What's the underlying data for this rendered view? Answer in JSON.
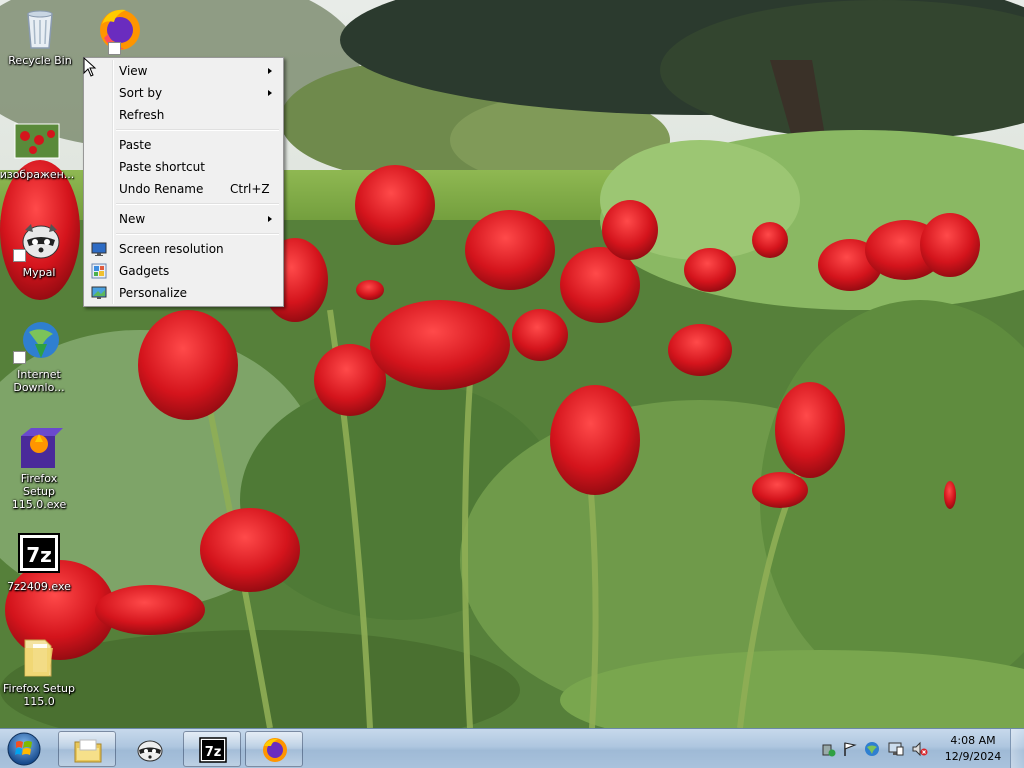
{
  "desktop": {
    "icons": [
      {
        "label": "Recycle Bin",
        "icon": "recycle-bin-icon"
      },
      {
        "label": "",
        "icon": "firefox-icon"
      },
      {
        "label": "изображен...",
        "icon": "image-thumbnail-icon"
      },
      {
        "label": "Mypal",
        "icon": "mypal-raccoon-icon"
      },
      {
        "label": "Internet Downlo...",
        "icon": "internet-download-manager-icon"
      },
      {
        "label": "Firefox Setup 115.0.exe",
        "icon": "installer-box-icon"
      },
      {
        "label": "7z2409.exe",
        "icon": "7zip-icon"
      },
      {
        "label": "Firefox Setup 115.0",
        "icon": "folder-icon"
      }
    ]
  },
  "context_menu": {
    "items": [
      {
        "label": "View",
        "submenu": true
      },
      {
        "label": "Sort by",
        "submenu": true
      },
      {
        "label": "Refresh"
      },
      {
        "label": "Paste"
      },
      {
        "label": "Paste shortcut"
      },
      {
        "label": "Undo Rename",
        "shortcut": "Ctrl+Z"
      },
      {
        "label": "New",
        "submenu": true
      },
      {
        "label": "Screen resolution",
        "icon": "monitor-icon"
      },
      {
        "label": "Gadgets",
        "icon": "gadgets-icon"
      },
      {
        "label": "Personalize",
        "icon": "personalize-icon"
      }
    ]
  },
  "taskbar": {
    "start": "start-orb-icon",
    "pinned": [
      "file-explorer-icon",
      "mypal-raccoon-icon",
      "7zip-icon",
      "firefox-icon"
    ],
    "tray": [
      "safely-remove-icon",
      "action-center-flag-icon",
      "network-globe-icon",
      "display-icon",
      "volume-muted-icon"
    ],
    "clock": {
      "time": "4:08 AM",
      "date": "12/9/2024"
    }
  },
  "colors": {
    "taskbar": "#aec6df",
    "menu_bg": "#f0f0f0",
    "menu_border": "#979797",
    "tulip_red": "#d4141c"
  }
}
